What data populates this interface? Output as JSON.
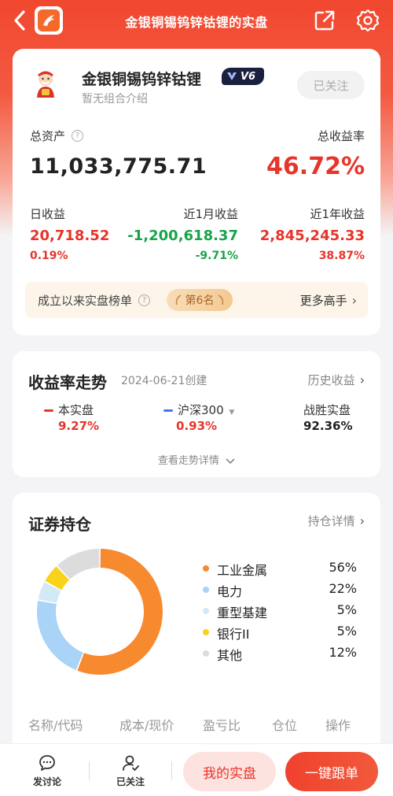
{
  "topbar": {
    "title": "金银铜锡钨锌钴锂的实盘"
  },
  "account": {
    "name": "金银铜锡钨锌钴锂",
    "level_badge": "V6",
    "description": "暂无组合介绍",
    "follow_label": "已关注"
  },
  "summary": {
    "total_assets_label": "总资产",
    "total_assets_value": "11,033,775.71",
    "total_return_label": "总收益率",
    "total_return_value": "46.72%",
    "stats": [
      {
        "label": "日收益",
        "value": "20,718.52",
        "pct": "0.19%"
      },
      {
        "label": "近1月收益",
        "value": "-1,200,618.37",
        "pct": "-9.71%"
      },
      {
        "label": "近1年收益",
        "value": "2,845,245.33",
        "pct": "38.87%"
      }
    ],
    "rank_label": "成立以来实盘榜单",
    "rank_badge": "第6名",
    "rank_more": "更多高手"
  },
  "trend": {
    "title": "收益率走势",
    "created": "2024-06-21创建",
    "history_link": "历史收益",
    "compare": [
      {
        "name": "本实盘",
        "value": "9.27%",
        "color": "#e8342a"
      },
      {
        "name": "沪深300",
        "value": "0.93%",
        "color": "#3a7be0"
      },
      {
        "name": "战胜实盘",
        "value": "92.36%"
      }
    ],
    "detail_link": "查看走势详情"
  },
  "holdings": {
    "title": "证券持仓",
    "detail_link": "持仓详情",
    "sectors": [
      {
        "name": "工业金属",
        "pct": "56%",
        "value": 56,
        "color": "#f7892f"
      },
      {
        "name": "电力",
        "pct": "22%",
        "value": 22,
        "color": "#a9d3f7"
      },
      {
        "name": "重型基建",
        "pct": "5%",
        "value": 5,
        "color": "#d2e9f8"
      },
      {
        "name": "银行II",
        "pct": "5%",
        "value": 5,
        "color": "#f9d21a"
      },
      {
        "name": "其他",
        "pct": "12%",
        "value": 12,
        "color": "#dcdcdc"
      }
    ],
    "table_headers": [
      "名称/代码",
      "成本/现价",
      "盈亏比",
      "仓位",
      "操作"
    ]
  },
  "bottom": {
    "discuss_label": "发讨论",
    "followed_label": "已关注",
    "my_portfolio": "我的实盘",
    "one_click_follow": "一键跟单"
  }
}
